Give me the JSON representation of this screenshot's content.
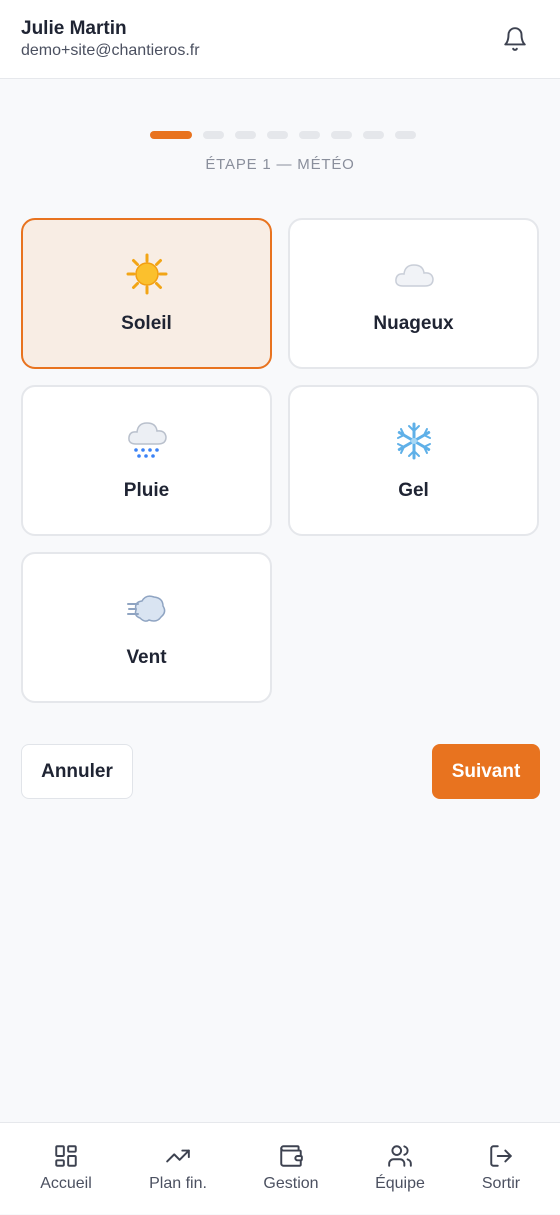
{
  "header": {
    "user_name": "Julie Martin",
    "user_email": "demo+site@chantieros.fr",
    "notifications_icon": "bell-icon"
  },
  "stepper": {
    "total_steps": 8,
    "current_step": 1,
    "label": "ÉTAPE 1 — MÉTÉO"
  },
  "weather_options": [
    {
      "label": "Soleil",
      "icon": "sun-icon",
      "selected": true
    },
    {
      "label": "Nuageux",
      "icon": "cloud-icon",
      "selected": false
    },
    {
      "label": "Pluie",
      "icon": "rain-cloud-icon",
      "selected": false
    },
    {
      "label": "Gel",
      "icon": "snowflake-icon",
      "selected": false
    },
    {
      "label": "Vent",
      "icon": "wind-icon",
      "selected": false
    }
  ],
  "actions": {
    "cancel_label": "Annuler",
    "next_label": "Suivant"
  },
  "bottom_nav": [
    {
      "label": "Accueil",
      "icon": "grid-icon"
    },
    {
      "label": "Plan fin.",
      "icon": "trending-up-icon"
    },
    {
      "label": "Gestion",
      "icon": "wallet-icon"
    },
    {
      "label": "Équipe",
      "icon": "users-icon"
    },
    {
      "label": "Sortir",
      "icon": "logout-icon"
    }
  ],
  "colors": {
    "accent": "#e8731f",
    "selected_bg": "#f8ede4",
    "page_bg": "#f8f9fb"
  }
}
